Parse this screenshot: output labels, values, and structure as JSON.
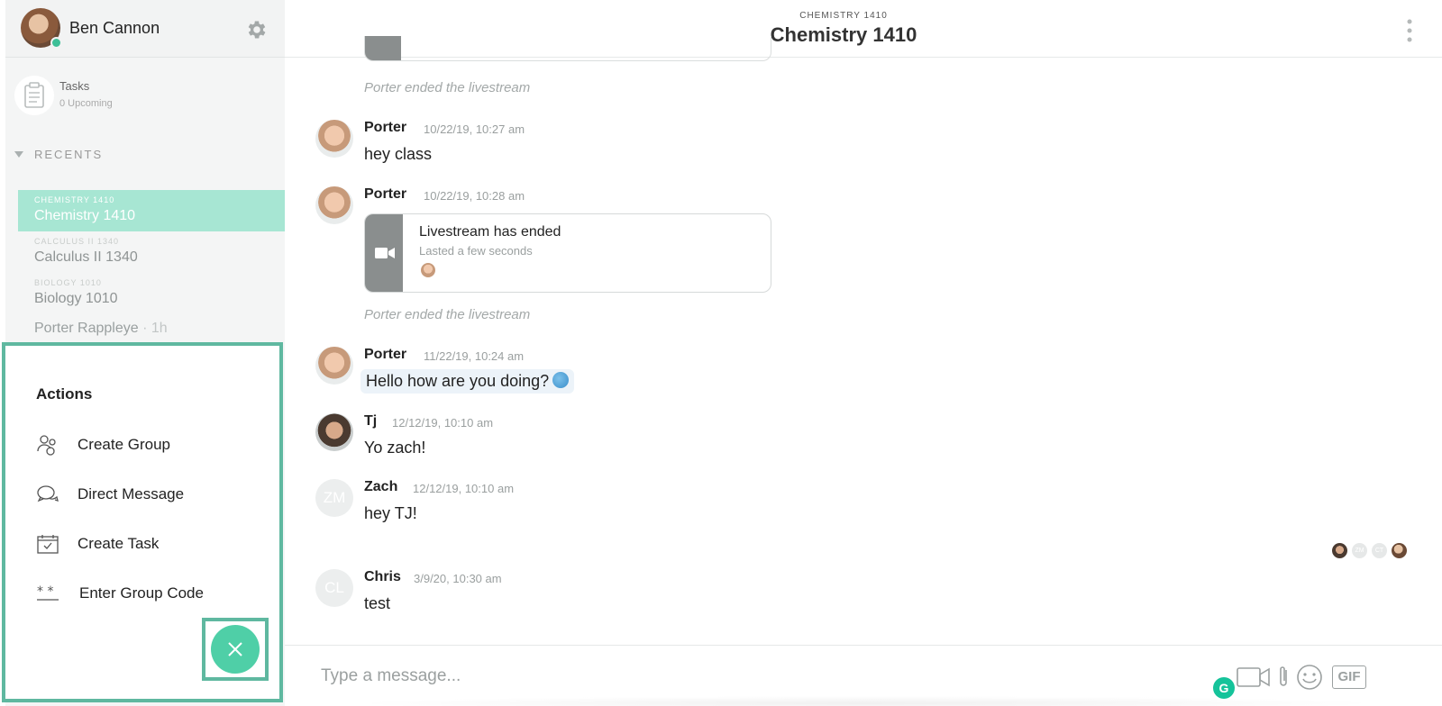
{
  "profile": {
    "name": "Ben Cannon",
    "status": "online"
  },
  "tasks": {
    "title": "Tasks",
    "subtitle": "0 Upcoming"
  },
  "recents": {
    "heading": "RECENTS",
    "items": [
      {
        "tag": "CHEMISTRY 1410",
        "name": "Chemistry 1410",
        "active": true
      },
      {
        "tag": "CALCULUS II 1340",
        "name": "Calculus II 1340",
        "active": false
      },
      {
        "tag": "BIOLOGY 1010",
        "name": "Biology 1010",
        "active": false
      }
    ],
    "dm": {
      "name": "Porter Rappleye",
      "time": "· 1h"
    }
  },
  "actions": {
    "title": "Actions",
    "items": [
      {
        "label": "Create Group",
        "icon": "group-icon"
      },
      {
        "label": "Direct Message",
        "icon": "chat-bubbles-icon"
      },
      {
        "label": "Create Task",
        "icon": "calendar-check-icon"
      },
      {
        "label": "Enter Group Code",
        "icon": "asterisks-icon"
      }
    ],
    "close_icon": "close-icon"
  },
  "header": {
    "tag": "CHEMISTRY 1410",
    "title": "Chemistry 1410"
  },
  "messages": {
    "system1": "Porter ended the livestream",
    "m1": {
      "name": "Porter",
      "time": "10/22/19, 10:27 am",
      "text": "hey class"
    },
    "m2": {
      "name": "Porter",
      "time": "10/22/19, 10:28 am",
      "card_title": "Livestream has ended",
      "card_sub": "Lasted a few seconds"
    },
    "system2": "Porter ended the livestream",
    "m3": {
      "name": "Porter",
      "time": "11/22/19, 10:24 am",
      "text": "Hello how are you doing?"
    },
    "m4": {
      "name": "Tj",
      "time": "12/12/19, 10:10 am",
      "text": "Yo zach!"
    },
    "m5": {
      "name": "Zach",
      "initials": "ZM",
      "time": "12/12/19, 10:10 am",
      "text": "hey TJ!"
    },
    "m6": {
      "name": "Chris",
      "initials": "CL",
      "time": "3/9/20, 10:30 am",
      "text": "test"
    }
  },
  "read_receipts": [
    "ZM",
    "CT"
  ],
  "composer": {
    "placeholder": "Type a message...",
    "gif_label": "GIF",
    "grammarly": "G"
  },
  "colors": {
    "accent": "#4fcfa7",
    "active_row": "#a7e6d3",
    "highlight_frame": "#5fb8a0"
  }
}
